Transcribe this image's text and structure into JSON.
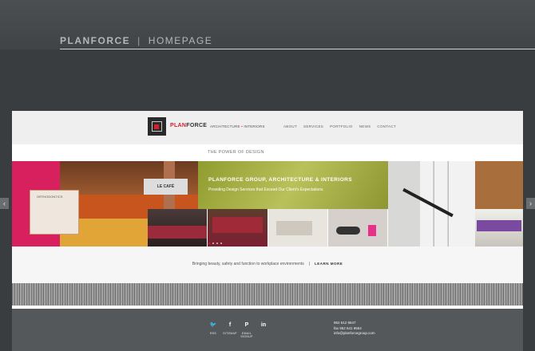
{
  "header": {
    "brand": "PLANFORCE",
    "separator": "|",
    "page": "HOMEPAGE"
  },
  "slider_nav": {
    "prev_glyph": "‹",
    "next_glyph": "›"
  },
  "site": {
    "logo": {
      "plan": "PLAN",
      "force": "FORCE"
    },
    "tagline": {
      "part1": "ARCHITECTURE",
      "dot": "•",
      "part2": "INTERIORS"
    },
    "nav": [
      "ABOUT",
      "SERVICES",
      "PORTFOLIO",
      "NEWS",
      "CONTACT"
    ],
    "section_title": "THE POWER OF DESIGN",
    "hero": {
      "title": "PLANFORCE GROUP, ARCHITECTURE & INTERIORS",
      "subtitle": "Providing Design Services that Exceed Our Client's Expectations",
      "left_sign": "LE CAFÉ",
      "counter_label": "ORTHODONTICS"
    },
    "band": {
      "text": "Bringing beauty, safety and function to workplace environments",
      "separator": "|",
      "link": "LEARN MORE"
    },
    "footer": {
      "social": [
        {
          "icon": "twitter-icon",
          "glyph": "🐦",
          "label": "RSS"
        },
        {
          "icon": "facebook-icon",
          "glyph": "f",
          "label": "SITEMAP"
        },
        {
          "icon": "pinterest-icon",
          "glyph": "P",
          "label": "EMAIL SIGNUP"
        },
        {
          "icon": "linkedin-icon",
          "glyph": "in",
          "label": ""
        }
      ],
      "contact": {
        "phone": "952 512 9547",
        "fax": "fax 952 541 9554",
        "email": "info@planforcegroup.com"
      }
    }
  },
  "colors": {
    "accent": "#d3202b",
    "footer_bg": "#55585b",
    "page_bg": "#3a3d40",
    "hero_green": "#9ba33a"
  }
}
